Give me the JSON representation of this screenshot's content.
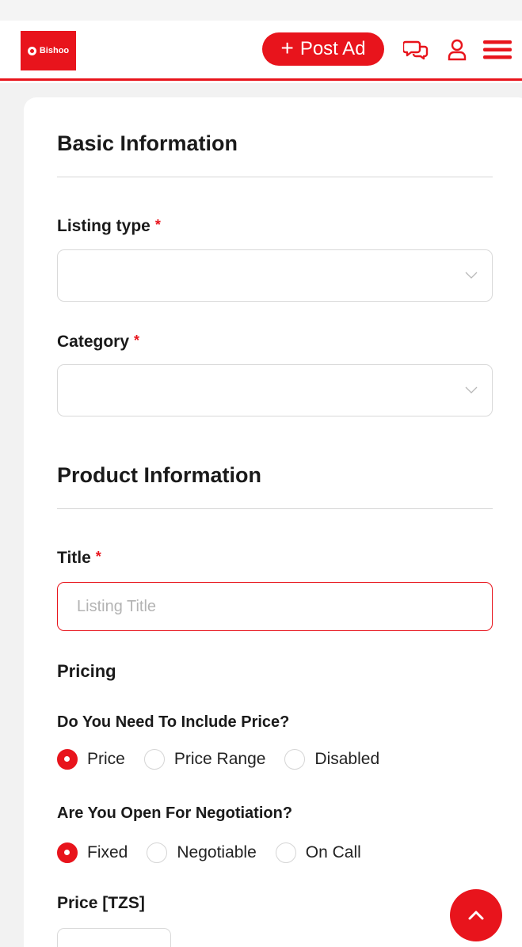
{
  "header": {
    "logo_text": "Bishoo",
    "post_ad_label": "Post Ad",
    "icons": [
      "chat-icon",
      "user-icon",
      "menu-icon"
    ]
  },
  "colors": {
    "accent": "#e8141c",
    "border": "#d9d9d9",
    "background": "#f2f2f2"
  },
  "basic_info": {
    "title": "Basic Information",
    "listing_type_label": "Listing type",
    "category_label": "Category",
    "required_mark": "*",
    "listing_type_value": "",
    "category_value": ""
  },
  "product_info": {
    "title": "Product Information",
    "title_label": "Title",
    "title_placeholder": "Listing Title",
    "title_value": ""
  },
  "pricing": {
    "heading": "Pricing",
    "include_price_question": "Do You Need To Include Price?",
    "include_price_options": [
      {
        "label": "Price",
        "checked": true
      },
      {
        "label": "Price Range",
        "checked": false
      },
      {
        "label": "Disabled",
        "checked": false
      }
    ],
    "negotiation_question": "Are You Open For Negotiation?",
    "negotiation_options": [
      {
        "label": "Fixed",
        "checked": true
      },
      {
        "label": "Negotiable",
        "checked": false
      },
      {
        "label": "On Call",
        "checked": false
      }
    ],
    "price_label": "Price [TZS]"
  }
}
